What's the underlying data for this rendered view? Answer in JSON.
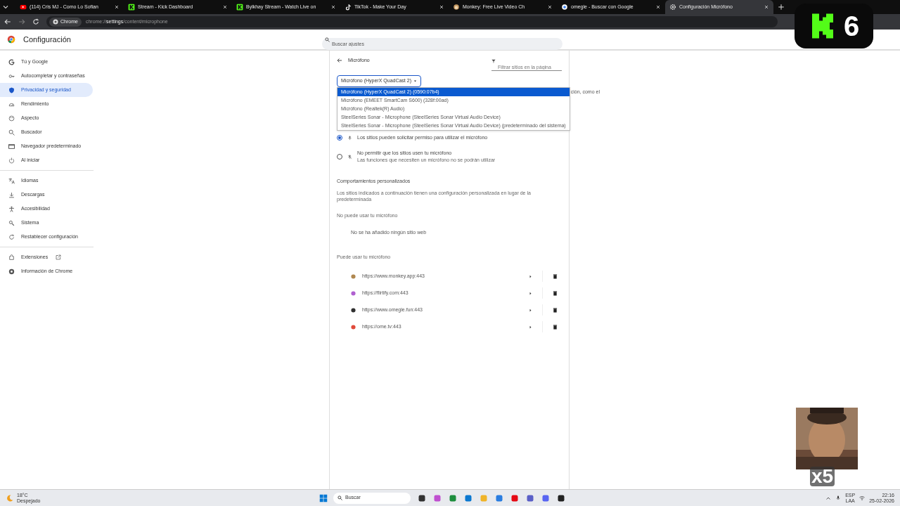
{
  "tabs": [
    {
      "title": "(114) Cris MJ - Como Lo Sofian",
      "selected": false
    },
    {
      "title": "Stream - Kick Dashboard",
      "selected": false
    },
    {
      "title": "Bylkhay Stream - Watch Live on",
      "selected": false
    },
    {
      "title": "TikTok - Make Your Day",
      "selected": false
    },
    {
      "title": "Monkey: Free Live Video Ch",
      "selected": false
    },
    {
      "title": "omegle - Buscar con Google",
      "selected": false
    },
    {
      "title": "Configuración Micrófono",
      "selected": true
    }
  ],
  "address_bar": {
    "chip": "Chrome",
    "url_prefix": "chrome://",
    "url_host": "settings",
    "url_path": "/content/microphone"
  },
  "overlay": {
    "badge_number": "6",
    "multiplier": "x5"
  },
  "header": {
    "title": "Configuración",
    "search_placeholder": "Buscar ajustes"
  },
  "sidebar": {
    "groups": [
      [
        {
          "label": "Tú y Google",
          "selected": false
        },
        {
          "label": "Autocompletar y contraseñas",
          "selected": false
        },
        {
          "label": "Privacidad y seguridad",
          "selected": true
        },
        {
          "label": "Rendimiento",
          "selected": false
        },
        {
          "label": "Aspecto",
          "selected": false
        },
        {
          "label": "Buscador",
          "selected": false
        },
        {
          "label": "Navegador predeterminado",
          "selected": false
        },
        {
          "label": "Al iniciar",
          "selected": false
        }
      ],
      [
        {
          "label": "Idiomas",
          "selected": false
        },
        {
          "label": "Descargas",
          "selected": false
        },
        {
          "label": "Accesibilidad",
          "selected": false
        },
        {
          "label": "Sistema",
          "selected": false
        },
        {
          "label": "Restablecer configuración",
          "selected": false
        }
      ],
      [
        {
          "label": "Extensiones",
          "selected": false,
          "external": true
        },
        {
          "label": "Información de Chrome",
          "selected": false,
          "external": false
        }
      ]
    ]
  },
  "page": {
    "title": "Micrófono",
    "filter_placeholder": "Filtrar sitios en la página",
    "select_value": "Micrófono (HyperX QuadCast 2)",
    "options": [
      {
        "label": "Micrófono (HyperX QuadCast 2) (0590:07b4)",
        "selected": true
      },
      {
        "label": "Micrófono (EMEET SmartCam S600) (328f:00ad)",
        "selected": false
      },
      {
        "label": "Micrófono (Realtek(R) Audio)",
        "selected": false
      },
      {
        "label": "SteelSeries Sonar - Microphone (SteelSeries Sonar Virtual Audio Device)",
        "selected": false
      },
      {
        "label": "SteelSeries Sonar - Microphone (SteelSeries Sonar Virtual Audio Device) (predeterminado del sistema)",
        "selected": false
      }
    ],
    "description_tail": "ción, como el",
    "radios": [
      {
        "label": "Los sitios pueden solicitar permiso para utilizar el micrófono",
        "selected": true
      },
      {
        "label": "No permitir que los sitios usen tu micrófono",
        "sublabel": "Las funciones que necesiten un micrófono no se podrán utilizar",
        "selected": false
      }
    ],
    "custom_title": "Comportamientos personalizados",
    "custom_desc": "Los sitios indicados a continuación tienen una configuración personalizada en lugar de la predeterminada",
    "blocked_title": "No puede usar tu micrófono",
    "blocked_empty": "No se ha añadido ningún sitio web",
    "allowed_title": "Puede usar tu micrófono",
    "allowed": [
      {
        "url": "https://www.monkey.app:443",
        "color": "#b08850"
      },
      {
        "url": "https://flirtify.com:443",
        "color": "#b060d0"
      },
      {
        "url": "https://www.omegle.fun:443",
        "color": "#303030"
      },
      {
        "url": "https://ome.tv:443",
        "color": "#e04a3a"
      }
    ]
  },
  "taskbar": {
    "temp": "18°C",
    "weather": "Despejado",
    "search": "Buscar",
    "lang": "ESP",
    "layout": "LAA",
    "time": "22:16",
    "date": "25-02-2026"
  }
}
